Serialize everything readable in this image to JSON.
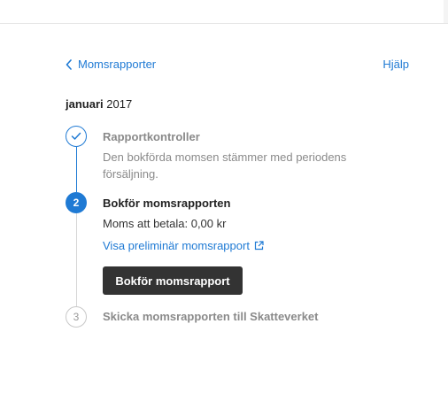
{
  "header": {
    "back_label": "Momsrapporter",
    "help_label": "Hjälp"
  },
  "period": {
    "month": "januari",
    "year": "2017"
  },
  "steps": [
    {
      "number": "1",
      "status": "completed",
      "title": "Rapportkontroller",
      "description": "Den bokförda momsen stämmer med periodens försäljning."
    },
    {
      "number": "2",
      "status": "active",
      "title": "Bokför momsrapporten",
      "amount_text": "Moms att betala: 0,00 kr",
      "link_label": "Visa preliminär momsrapport",
      "button_label": "Bokför momsrapport"
    },
    {
      "number": "3",
      "status": "pending",
      "title": "Skicka momsrapporten till Skatteverket"
    }
  ],
  "colors": {
    "accent": "#1f7ad4",
    "button_bg": "#333333",
    "muted_text": "#8a8a8a"
  },
  "icons": {
    "back": "chevron-left-icon",
    "completed": "checkmark-icon",
    "external": "external-link-icon"
  }
}
